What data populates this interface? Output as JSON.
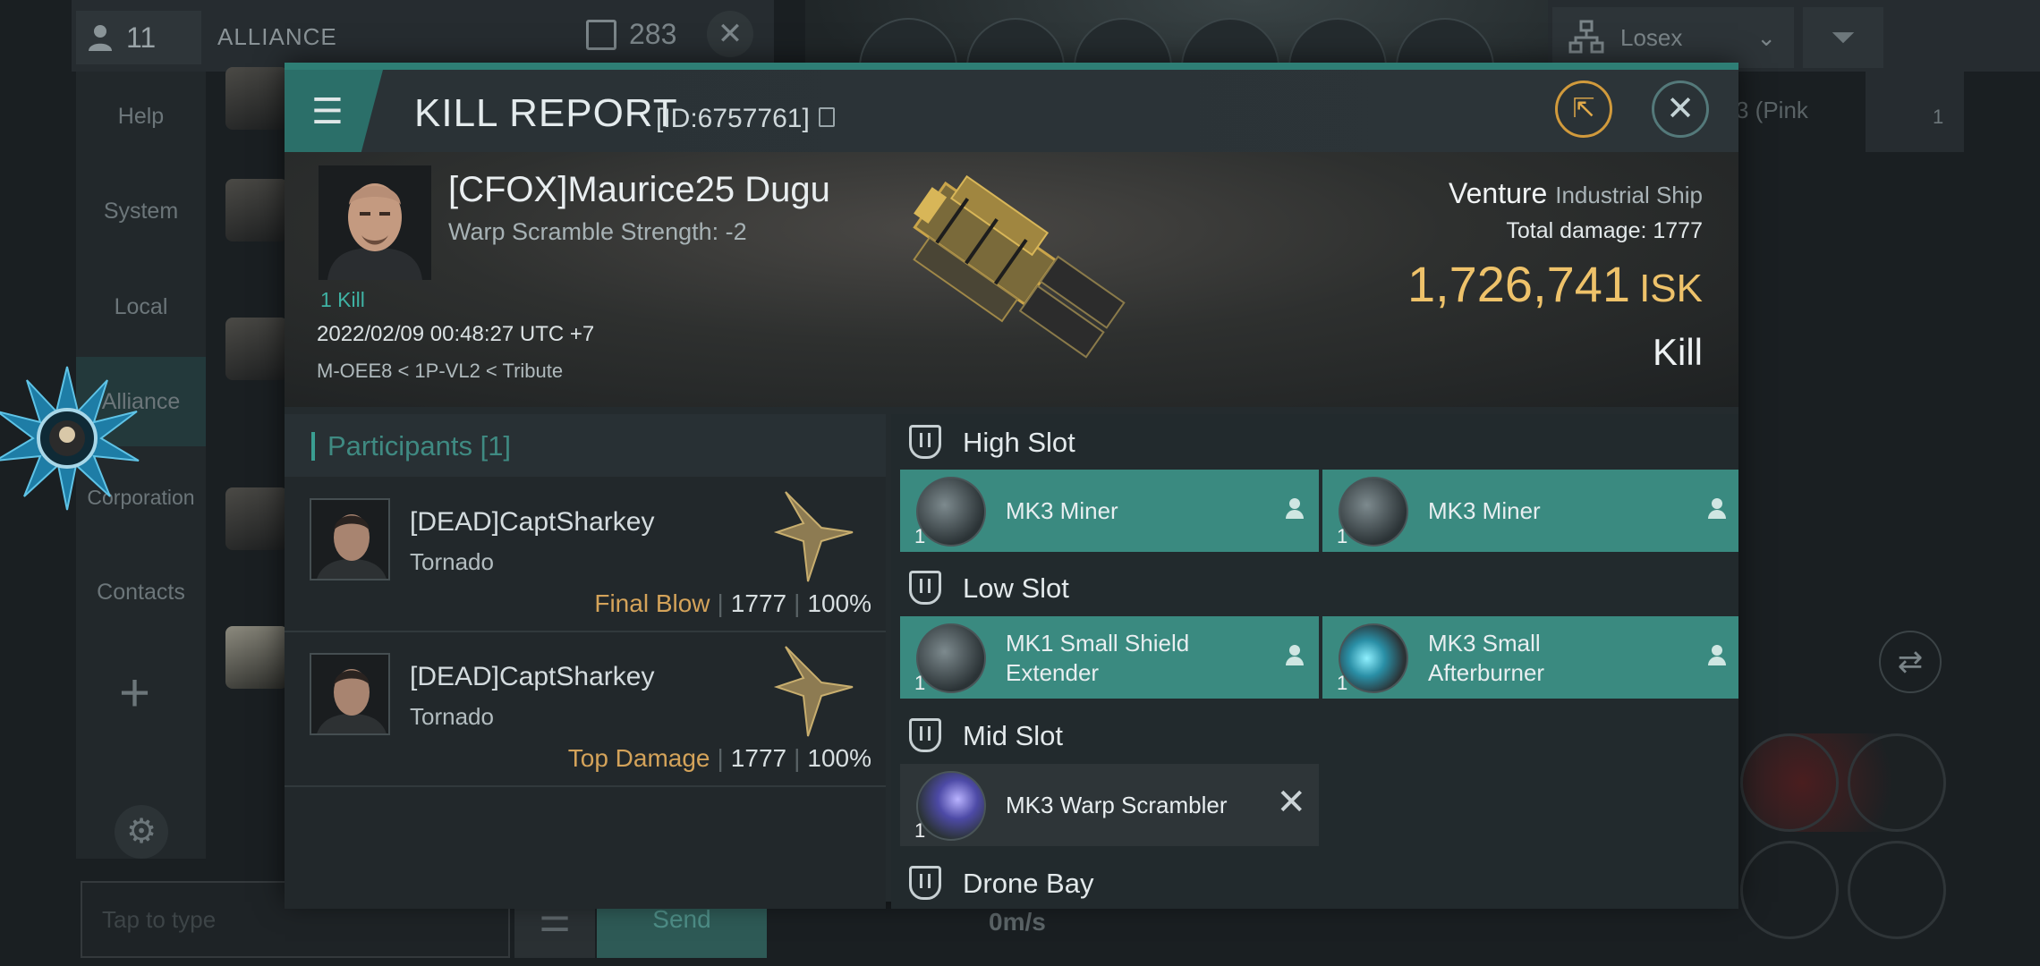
{
  "background": {
    "member_count": "11",
    "channel_label": "ALLIANCE",
    "channel_count": "283",
    "sidebar": [
      "Help",
      "System",
      "Local",
      "Alliance",
      "Corporation",
      "Contacts"
    ],
    "send_label": "Send",
    "speed": "0m/s",
    "input_placeholder": "Tap to type",
    "losex_label": "Losex",
    "pink_label": "3 (Pink",
    "badge": "1"
  },
  "dialog": {
    "title": "KILL REPORT",
    "id": "[ID:6757761]",
    "victim": {
      "name": "[CFOX]Maurice25 Dugu",
      "warp_scramble": "Warp Scramble Strength:  -2",
      "kills": "1 Kill",
      "datetime": "2022/02/09 00:48:27 UTC +7",
      "location": "M-OEE8 < 1P-VL2 < Tribute"
    },
    "ship": {
      "name": "Venture",
      "class": "Industrial Ship",
      "total_damage_label": "Total damage:",
      "total_damage": "1777",
      "isk_value": "1,726,741",
      "isk_unit": "ISK",
      "kill_type": "Kill"
    },
    "participants": {
      "header": "Participants [1]",
      "rows": [
        {
          "name": "[DEAD]CaptSharkey",
          "ship": "Tornado",
          "label": "Final Blow",
          "damage": "1777",
          "percent": "100%"
        },
        {
          "name": "[DEAD]CaptSharkey",
          "ship": "Tornado",
          "label": "Top Damage",
          "damage": "1777",
          "percent": "100%"
        }
      ]
    },
    "slots": {
      "high": {
        "title": "High Slot",
        "items": [
          {
            "name": "MK3 Miner",
            "qty": "1"
          },
          {
            "name": "MK3 Miner",
            "qty": "1"
          }
        ]
      },
      "low": {
        "title": "Low Slot",
        "items": [
          {
            "name1": "MK1 Small Shield",
            "name2": "Extender",
            "qty": "1"
          },
          {
            "name1": "MK3 Small",
            "name2": "Afterburner",
            "qty": "1"
          }
        ]
      },
      "mid": {
        "title": "Mid Slot",
        "items": [
          {
            "name": "MK3 Warp Scrambler",
            "qty": "1"
          }
        ]
      },
      "drone": {
        "title": "Drone Bay"
      }
    }
  }
}
